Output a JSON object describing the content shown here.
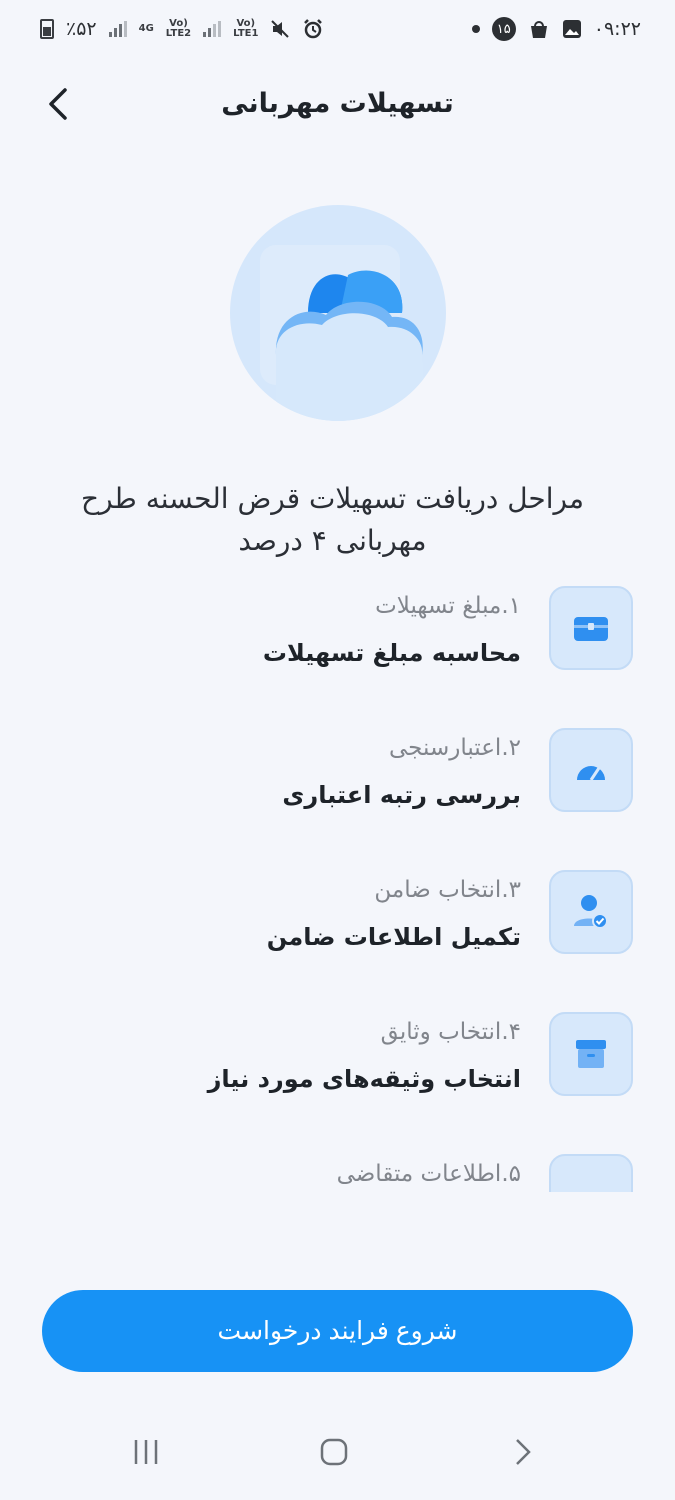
{
  "status_bar": {
    "battery_text": "٪۵۲",
    "net_1": "4G",
    "lte_2": "Vo)\nLTE2",
    "lte_1": "Vo)\nLTE1",
    "badge_number": "۱۵",
    "time": "۰۹:۲۲"
  },
  "header": {
    "title": "تسهیلات مهربانی"
  },
  "intro": {
    "text": "مراحل دریافت تسهیلات قرض الحسنه طرح مهربانی ۴ درصد"
  },
  "steps": [
    {
      "title": "۱.مبلغ تسهیلات",
      "description": "محاسبه مبلغ تسهیلات",
      "icon": "wallet-icon"
    },
    {
      "title": "۲.اعتبارسنجی",
      "description": "بررسی رتبه اعتباری",
      "icon": "gauge-icon"
    },
    {
      "title": "۳.انتخاب ضامن",
      "description": "تکمیل اطلاعات ضامن",
      "icon": "user-check-icon"
    },
    {
      "title": "۴.انتخاب وثایق",
      "description": "انتخاب وثیقه‌های مورد نیاز",
      "icon": "archive-box-icon"
    },
    {
      "title": "۵.اطلاعات متقاضی",
      "description": "",
      "icon": "user-icon"
    }
  ],
  "actions": {
    "start_label": "شروع فرایند درخواست"
  },
  "colors": {
    "accent": "#1792f5",
    "icon_bg": "#d7e8fb",
    "icon_fg": "#2f8ff0",
    "background": "#f4f6fb"
  }
}
